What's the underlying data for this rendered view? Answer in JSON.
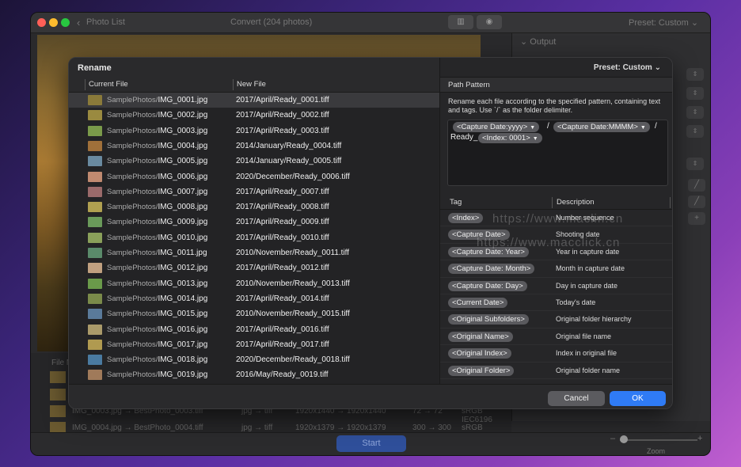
{
  "window": {
    "title": "Photo List",
    "center_title": "Convert (204 photos)",
    "preset": "Preset: Custom",
    "output_label": "Output",
    "start_label": "Start",
    "zoom_label": "Zoom",
    "file_header": "File N"
  },
  "bg_rows": [
    {
      "name": "IMG_0003.jpg → BestPhoto_0003.tiff",
      "type": "jpg → tiff",
      "size": "1920x1440 → 1920x1440",
      "dpi": "72 → 72",
      "profile": "sRGB IEC6196"
    },
    {
      "name": "IMG_0004.jpg → BestPhoto_0004.tiff",
      "type": "jpg → tiff",
      "size": "1920x1379 → 1920x1379",
      "dpi": "300 → 300",
      "profile": "sRGB IEC619("
    }
  ],
  "dialog": {
    "title": "Rename",
    "preset": "Preset: Custom",
    "col_current": "Current File",
    "col_new": "New File",
    "files": [
      {
        "dir": "SamplePhotos/",
        "file": "IMG_0001.jpg",
        "new": "2017/April/Ready_0001.tiff"
      },
      {
        "dir": "SamplePhotos/",
        "file": "IMG_0002.jpg",
        "new": "2017/April/Ready_0002.tiff"
      },
      {
        "dir": "SamplePhotos/",
        "file": "IMG_0003.jpg",
        "new": "2017/April/Ready_0003.tiff"
      },
      {
        "dir": "SamplePhotos/",
        "file": "IMG_0004.jpg",
        "new": "2014/January/Ready_0004.tiff"
      },
      {
        "dir": "SamplePhotos/",
        "file": "IMG_0005.jpg",
        "new": "2014/January/Ready_0005.tiff"
      },
      {
        "dir": "SamplePhotos/",
        "file": "IMG_0006.jpg",
        "new": "2020/December/Ready_0006.tiff"
      },
      {
        "dir": "SamplePhotos/",
        "file": "IMG_0007.jpg",
        "new": "2017/April/Ready_0007.tiff"
      },
      {
        "dir": "SamplePhotos/",
        "file": "IMG_0008.jpg",
        "new": "2017/April/Ready_0008.tiff"
      },
      {
        "dir": "SamplePhotos/",
        "file": "IMG_0009.jpg",
        "new": "2017/April/Ready_0009.tiff"
      },
      {
        "dir": "SamplePhotos/",
        "file": "IMG_0010.jpg",
        "new": "2017/April/Ready_0010.tiff"
      },
      {
        "dir": "SamplePhotos/",
        "file": "IMG_0011.jpg",
        "new": "2010/November/Ready_0011.tiff"
      },
      {
        "dir": "SamplePhotos/",
        "file": "IMG_0012.jpg",
        "new": "2017/April/Ready_0012.tiff"
      },
      {
        "dir": "SamplePhotos/",
        "file": "IMG_0013.jpg",
        "new": "2010/November/Ready_0013.tiff"
      },
      {
        "dir": "SamplePhotos/",
        "file": "IMG_0014.jpg",
        "new": "2017/April/Ready_0014.tiff"
      },
      {
        "dir": "SamplePhotos/",
        "file": "IMG_0015.jpg",
        "new": "2010/November/Ready_0015.tiff"
      },
      {
        "dir": "SamplePhotos/",
        "file": "IMG_0016.jpg",
        "new": "2017/April/Ready_0016.tiff"
      },
      {
        "dir": "SamplePhotos/",
        "file": "IMG_0017.jpg",
        "new": "2017/April/Ready_0017.tiff"
      },
      {
        "dir": "SamplePhotos/",
        "file": "IMG_0018.jpg",
        "new": "2020/December/Ready_0018.tiff"
      },
      {
        "dir": "SamplePhotos/",
        "file": "IMG_0019.jpg",
        "new": "2016/May/Ready_0019.tiff"
      }
    ],
    "path_pattern": {
      "title": "Path Pattern",
      "description": "Rename each file according to the specified pattern, containing text and tags. Use `/` as the folder delimiter.",
      "token1": "<Capture Date:yyyy>",
      "sep1": "/",
      "token2": "<Capture Date:MMMM>",
      "sep2": "/",
      "text": "Ready_",
      "token3": "<Index: 0001>"
    },
    "tag_col": "Tag",
    "desc_col": "Description",
    "tags": [
      {
        "tag": "<Index>",
        "desc": "Number sequence"
      },
      {
        "tag": "<Capture Date>",
        "desc": "Shooting date"
      },
      {
        "tag": "<Capture Date: Year>",
        "desc": "Year in capture date"
      },
      {
        "tag": "<Capture Date: Month>",
        "desc": "Month in capture date"
      },
      {
        "tag": "<Capture Date: Day>",
        "desc": "Day in capture date"
      },
      {
        "tag": "<Current Date>",
        "desc": "Today's date"
      },
      {
        "tag": "<Original Subfolders>",
        "desc": "Original folder hierarchy"
      },
      {
        "tag": "<Original Name>",
        "desc": "Original file name"
      },
      {
        "tag": "<Original Index>",
        "desc": "Index in original file"
      },
      {
        "tag": "<Original Folder>",
        "desc": "Original folder name"
      }
    ],
    "cancel_label": "Cancel",
    "ok_label": "OK"
  },
  "watermarks": {
    "w1": "https://www.maclin.cn",
    "w2": "https://www.macclick.cn"
  },
  "colors": {
    "accent": "#2f7bf5",
    "selection": "#3a3a3d",
    "tag_pill": "#5a5a5e"
  }
}
